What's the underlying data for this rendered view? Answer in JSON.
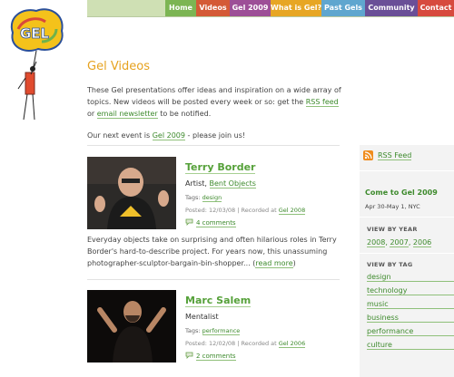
{
  "logo": {
    "text": "GEL"
  },
  "nav": {
    "items": [
      {
        "label": "Home",
        "color": "#7cb553",
        "width": 34
      },
      {
        "label": "Videos",
        "color": "#d45a36",
        "width": 37
      },
      {
        "label": "Gel 2009",
        "color": "#9d4f97",
        "width": 45
      },
      {
        "label": "What is Gel?",
        "color": "#e7a624",
        "width": 56
      },
      {
        "label": "Past Gels",
        "color": "#5fa6cf",
        "width": 48
      },
      {
        "label": "Community",
        "color": "#6a4f97",
        "width": 58
      },
      {
        "label": "Contact",
        "color": "#d74a3e",
        "width": 40
      }
    ]
  },
  "main": {
    "title": "Gel Videos",
    "intro_1a": "These Gel presentations offer ideas and inspiration on a wide array of topics. New videos will be posted every week or so: get the ",
    "intro_1_rss": "RSS feed",
    "intro_1b": " or ",
    "intro_1_newsletter": "email newsletter",
    "intro_1c": " to be notified.",
    "intro_2a": "Our next event is ",
    "intro_2_link": "Gel 2009",
    "intro_2b": " - please join us!"
  },
  "videos": [
    {
      "name": "Terry Border",
      "role_prefix": "Artist, ",
      "role_link": "Bent Objects",
      "tags_label": "Tags: ",
      "tags": [
        "design"
      ],
      "posted": "Posted: 12/03/08 | Recorded at ",
      "recorded_at": "Gel 2008",
      "comments": "4 comments",
      "desc": "Everyday objects take on surprising and often hilarious roles in Terry Border's hard-to-describe project. For years now, this unassuming photographer-sculptor-bargain-bin-shopper... ",
      "read_more": "read more"
    },
    {
      "name": "Marc Salem",
      "role_prefix": "Mentalist",
      "tags_label": "Tags: ",
      "tags": [
        "performance"
      ],
      "posted": "Posted: 12/02/08 | Recorded at ",
      "recorded_at": "Gel 2006",
      "comments": "2 comments"
    }
  ],
  "sidebar": {
    "rss": "RSS Feed",
    "event_title": "Come to Gel 2009",
    "event_dates": "Apr 30-May 1, NYC",
    "by_year_heading": "VIEW BY YEAR",
    "years": [
      "2008",
      "2007",
      "2006"
    ],
    "by_tag_heading": "VIEW BY TAG",
    "tags": [
      "design",
      "technology",
      "music",
      "business",
      "performance",
      "culture"
    ]
  },
  "colors": {
    "link": "#3d8a2c",
    "title": "#e6a21f",
    "sidebar_bg": "#f3f3f3"
  }
}
